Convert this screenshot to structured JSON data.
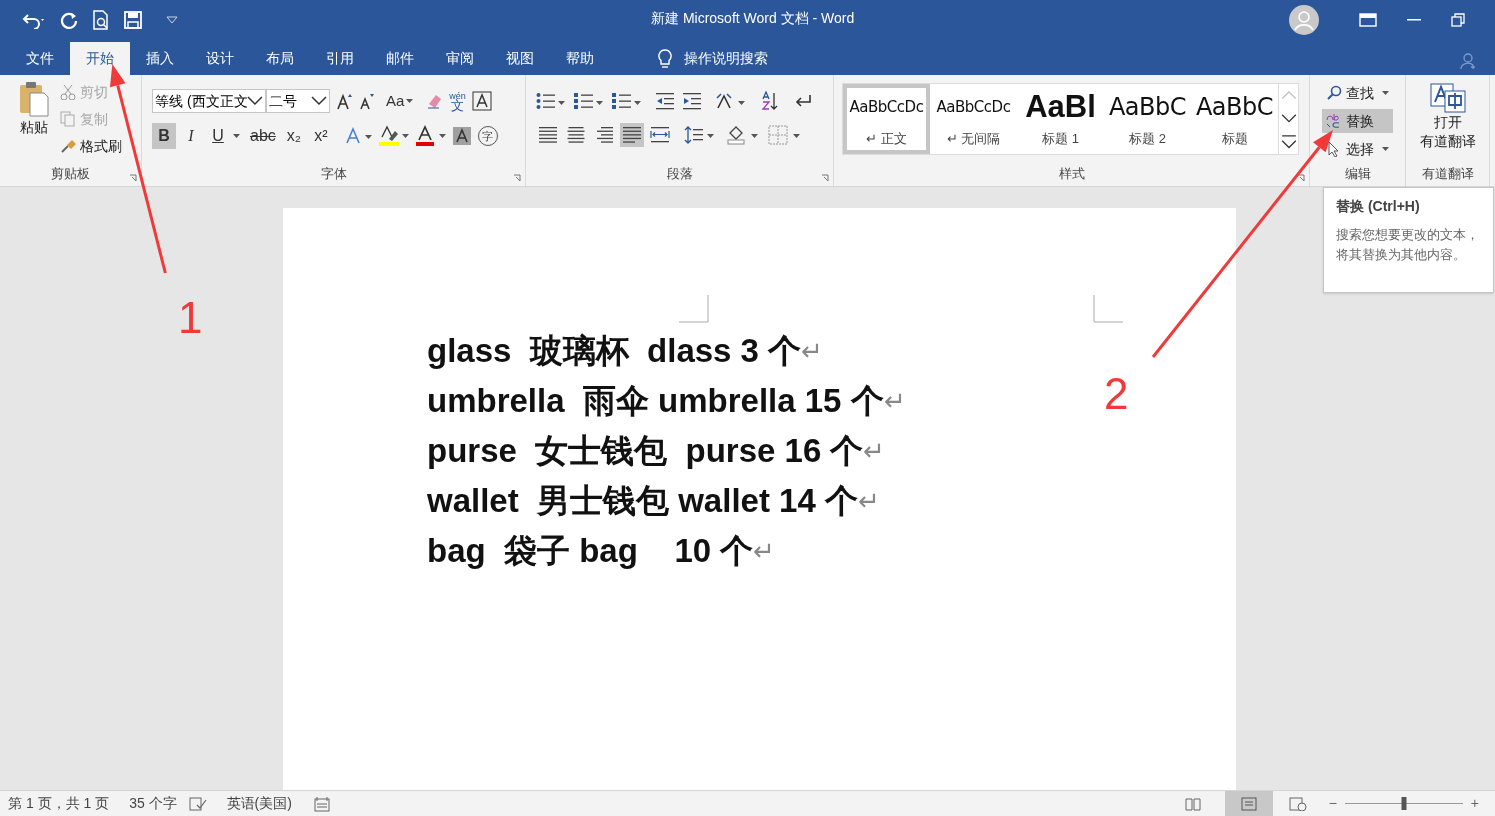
{
  "window": {
    "title": "新建 Microsoft Word 文档 - Word"
  },
  "tabs": [
    {
      "label": "文件",
      "selected": false
    },
    {
      "label": "开始",
      "selected": true
    },
    {
      "label": "插入",
      "selected": false
    },
    {
      "label": "设计",
      "selected": false
    },
    {
      "label": "布局",
      "selected": false
    },
    {
      "label": "引用",
      "selected": false
    },
    {
      "label": "邮件",
      "selected": false
    },
    {
      "label": "审阅",
      "selected": false
    },
    {
      "label": "视图",
      "selected": false
    },
    {
      "label": "帮助",
      "selected": false
    }
  ],
  "tell_me": "操作说明搜索",
  "clipboard": {
    "label": "剪贴板",
    "paste": "粘贴",
    "items": [
      {
        "label": "剪切",
        "disabled": true
      },
      {
        "label": "复制",
        "disabled": true
      },
      {
        "label": "格式刷",
        "disabled": false
      }
    ]
  },
  "font": {
    "label": "字体",
    "font_name": "等线 (西文正文",
    "font_size": "二号",
    "case_button": "Aa",
    "phonetic": "wén",
    "phonetic_char": "文",
    "format_buttons": [
      {
        "text": "B",
        "kind": "bold",
        "on": true
      },
      {
        "text": "I",
        "kind": "italic",
        "on": false
      },
      {
        "text": "U",
        "kind": "underline",
        "on": false
      },
      {
        "text": "abc",
        "kind": "strike",
        "on": false
      },
      {
        "text": "x₂",
        "kind": "sub",
        "on": false
      },
      {
        "text": "x²",
        "kind": "sup",
        "on": false
      }
    ],
    "enclose_char": "字"
  },
  "paragraph": {
    "label": "段落",
    "alignments": [
      {
        "selected": false
      },
      {
        "selected": false
      },
      {
        "selected": false
      },
      {
        "selected": true
      },
      {
        "selected": false
      }
    ]
  },
  "styles": {
    "label": "样式",
    "items": [
      {
        "preview": "AaBbCcDc",
        "name": "↵ 正文",
        "kind": "body",
        "selected": true
      },
      {
        "preview": "AaBbCcDc",
        "name": "↵ 无间隔",
        "kind": "body",
        "selected": false
      },
      {
        "preview": "AaBl",
        "name": "标题 1",
        "kind": "heading1",
        "selected": false
      },
      {
        "preview": "AaBbC",
        "name": "标题 2",
        "kind": "heading",
        "selected": false
      },
      {
        "preview": "AaBbC",
        "name": "标题",
        "kind": "heading",
        "selected": false
      }
    ]
  },
  "editing": {
    "label": "编辑",
    "items": [
      {
        "label": "查找",
        "kind": "find",
        "selected": false
      },
      {
        "label": "替换",
        "kind": "replace",
        "selected": true
      },
      {
        "label": "选择",
        "kind": "select",
        "selected": false
      }
    ]
  },
  "translate": {
    "button_lines": [
      "打开",
      "有道翻译"
    ],
    "label": "有道翻译"
  },
  "tooltip": {
    "title": "替换 (Ctrl+H)",
    "body": "搜索您想要更改的文本，将其替换为其他内容。"
  },
  "document": {
    "lines": [
      "glass  玻璃杯  dlass 3 个",
      "umbrella  雨伞 umbrella 15 个",
      "purse  女士钱包  purse 16 个",
      "wallet  男士钱包 wallet 14 个",
      "bag  袋子 bag    10 个"
    ],
    "paragraph_mark": "↵"
  },
  "status_bar": {
    "page": "第 1 页，共 1 页",
    "words": "35 个字",
    "language": "英语(美国)",
    "zoom": {
      "level": 0.5
    },
    "zoom_out": "−",
    "zoom_in": "+"
  },
  "annotations": [
    {
      "label": "1"
    },
    {
      "label": "2"
    }
  ]
}
